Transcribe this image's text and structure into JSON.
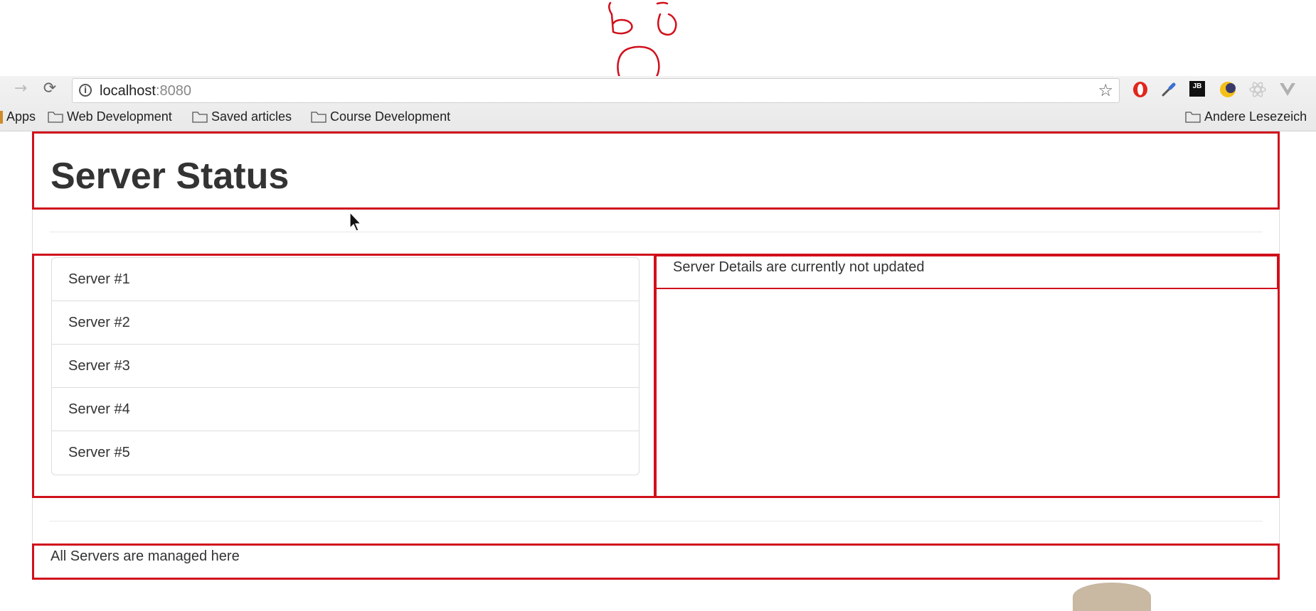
{
  "browser": {
    "url_host": "localhost",
    "url_port": ":8080",
    "bookmarks": [
      {
        "label": "Apps"
      },
      {
        "label": "Web Development"
      },
      {
        "label": "Saved articles"
      },
      {
        "label": "Course Development"
      }
    ],
    "bookmarks_right": "Andere Lesezeich",
    "extension_badge": "JB"
  },
  "page": {
    "title": "Server Status",
    "servers": [
      "Server #1",
      "Server #2",
      "Server #3",
      "Server #4",
      "Server #5"
    ],
    "details_text": "Server Details are currently not updated",
    "footer_text": "All Servers are managed here"
  },
  "colors": {
    "annotation_red": "#d0101c",
    "text": "#333333"
  }
}
